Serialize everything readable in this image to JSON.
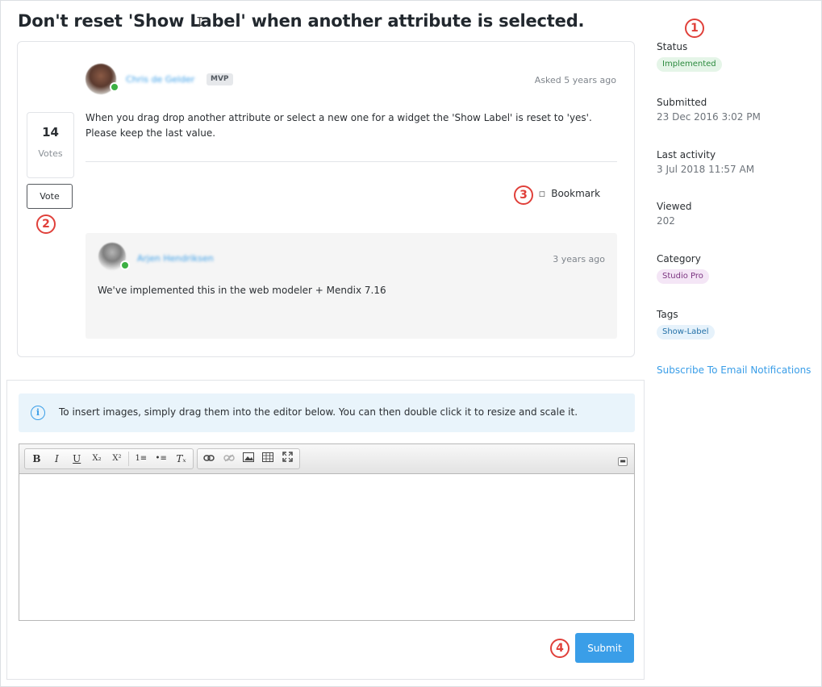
{
  "question": {
    "title": "Don't reset 'Show Label' when another attribute is selected.",
    "author": "Chris de Gelder",
    "author_badge": "MVP",
    "asked_time": "Asked 5 years ago",
    "body": "When you drag drop another attribute or select a new one for a widget the 'Show Label' is reset to 'yes'. Please keep the last value.",
    "votes": {
      "count": "14",
      "label": "Votes",
      "button_label": "Vote"
    },
    "bookmark_label": "Bookmark"
  },
  "reply": {
    "author": "Arjen Hendriksen",
    "time": "3 years ago",
    "body": "We've implemented this in the web modeler + Mendix 7.16"
  },
  "sidebar": {
    "status": {
      "label": "Status",
      "value": "Implemented"
    },
    "submitted": {
      "label": "Submitted",
      "value": "23 Dec 2016 3:02 PM"
    },
    "last_activity": {
      "label": "Last activity",
      "value": "3 Jul 2018 11:57 AM"
    },
    "viewed": {
      "label": "Viewed",
      "value": "202"
    },
    "category": {
      "label": "Category",
      "value": "Studio Pro"
    },
    "tags": {
      "label": "Tags",
      "items": [
        "Show-Label"
      ]
    },
    "subscribe_label": "Subscribe To Email Notifications"
  },
  "editor": {
    "info_text": "To insert images, simply drag them into the editor below. You can then double click it to resize and scale it.",
    "toolbar": {
      "group1": [
        "B",
        "I",
        "U",
        "X₂",
        "X²",
        "1≡",
        "•≡",
        "Tₓ"
      ],
      "group2": [
        "link-icon",
        "unlink-icon",
        "image-icon",
        "table-icon",
        "maximize-icon"
      ]
    },
    "submit_label": "Submit"
  },
  "markers": [
    "1",
    "2",
    "3",
    "4"
  ],
  "colors": {
    "accent": "#3a9ee8",
    "marker": "#e0403a",
    "status_green": "#2b8a3e"
  }
}
